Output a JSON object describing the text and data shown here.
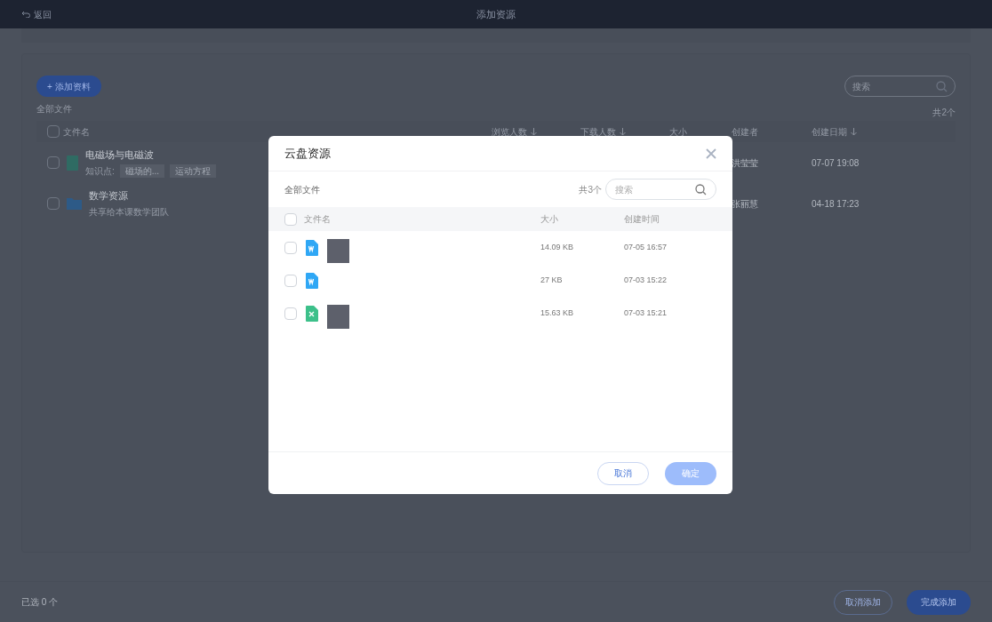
{
  "top_bar": {
    "back": "返回",
    "title": "添加资源"
  },
  "toolbar": {
    "add_button": "+ 添加资料",
    "search": {
      "placeholder": "搜索"
    }
  },
  "breadcrumb": "全部文件",
  "count": "共2个",
  "table": {
    "select_all": false,
    "columns": [
      {
        "label": "文件名",
        "sortable": false
      },
      {
        "label": "浏览人数",
        "sortable": true
      },
      {
        "label": "下载人数",
        "sortable": true
      },
      {
        "label": "大小",
        "sortable": false
      },
      {
        "label": "创建者",
        "sortable": false
      },
      {
        "label": "创建日期",
        "sortable": true
      }
    ],
    "rows": [
      {
        "kind": "file",
        "name": "电磁场与电磁波",
        "checked": false,
        "tags_label": "知识点:",
        "tags": [
          "磁场的...",
          "运动方程"
        ],
        "creator": "洪莹莹",
        "date": "07-07 19:08"
      },
      {
        "kind": "folder",
        "name": "数学资源",
        "checked": false,
        "subtitle": "共享给本课数学团队",
        "creator": "张丽慧",
        "date": "04-18 17:23"
      }
    ]
  },
  "footer": {
    "selected": "已选 0 个",
    "cancel": "取消添加",
    "done": "完成添加"
  },
  "dialog": {
    "title": "云盘资源",
    "breadcrumb": "全部文件",
    "count": "共3个",
    "search": {
      "placeholder": "搜索"
    },
    "columns": [
      "文件名",
      "大小",
      "创建时间"
    ],
    "select_all": false,
    "rows": [
      {
        "kind": "word",
        "checked": false,
        "redacted": true,
        "size": "14.09 KB",
        "time": "07-05 16:57"
      },
      {
        "kind": "word",
        "checked": false,
        "redacted": false,
        "size": "27 KB",
        "time": "07-03 15:22"
      },
      {
        "kind": "excel",
        "checked": false,
        "redacted": true,
        "size": "15.63 KB",
        "time": "07-03 15:21"
      }
    ],
    "cancel": "取消",
    "confirm": {
      "label": "确定",
      "disabled": true
    }
  }
}
